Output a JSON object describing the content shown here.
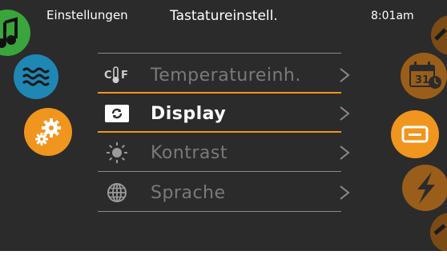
{
  "header": {
    "left_label": "Einstellungen",
    "title": "Tastatureinstell.",
    "time": "8:01am"
  },
  "menu": {
    "items": [
      {
        "label": "Temperatureinh.",
        "icon": "temperature-unit-icon",
        "selected": false
      },
      {
        "label": "Display",
        "icon": "display-refresh-icon",
        "selected": true
      },
      {
        "label": "Kontrast",
        "icon": "contrast-sun-icon",
        "selected": false
      },
      {
        "label": "Sprache",
        "icon": "globe-icon",
        "selected": false
      }
    ]
  },
  "calendar_icon_text": "31",
  "left_buttons": [
    {
      "icon": "music-note-icon",
      "color": "#3aa53a"
    },
    {
      "icon": "water-waves-icon",
      "color": "#1f87b4"
    },
    {
      "icon": "gears-icon",
      "color": "#f0951e"
    }
  ],
  "right_buttons": [
    {
      "icon": "wrench-icon",
      "color": "#7a4b14"
    },
    {
      "icon": "calendar-icon",
      "color": "#9a5e1a"
    },
    {
      "icon": "screen-icon",
      "color": "#f0951e"
    },
    {
      "icon": "lightning-icon",
      "color": "#9a5e1a"
    },
    {
      "icon": "wrench-icon",
      "color": "#7a4b14"
    }
  ],
  "colors": {
    "accent": "#f0951e",
    "background": "#2b2b2b",
    "dim_text": "#7a7a7a",
    "divider": "#8a8a8a"
  }
}
